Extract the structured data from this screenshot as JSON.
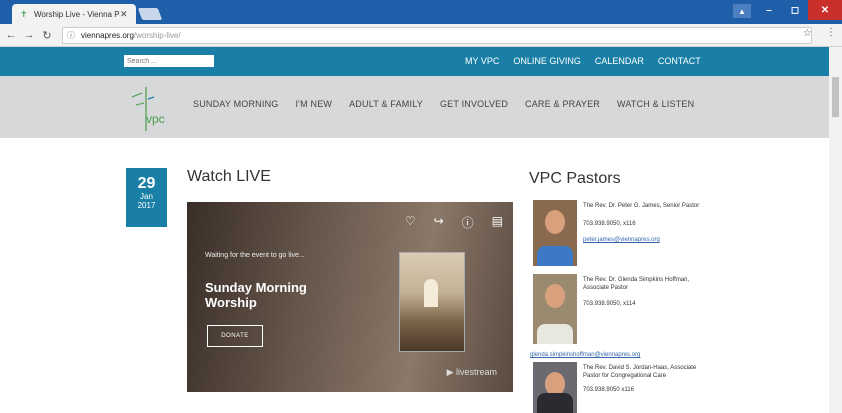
{
  "browser": {
    "tab_title": "Worship Live - Vienna P",
    "url_host": "viennapres.org",
    "url_path": "/worship-live/"
  },
  "site": {
    "search_placeholder": "Search ...",
    "top_links": [
      "MY VPC",
      "ONLINE GIVING",
      "CALENDAR",
      "CONTACT"
    ],
    "logo_text": "vpc",
    "nav_links": [
      "SUNDAY MORNING",
      "I'M NEW",
      "ADULT & FAMILY",
      "GET INVOLVED",
      "CARE & PRAYER",
      "WATCH & LISTEN"
    ]
  },
  "post": {
    "day": "29",
    "month": "Jan",
    "year": "2017",
    "title": "Watch LIVE"
  },
  "video": {
    "waiting_text": "Waiting for the event to go live...",
    "event_title": "Sunday Morning Worship",
    "donate_label": "DONATE",
    "brand": "livestream"
  },
  "pastors": {
    "title": "VPC Pastors",
    "items": [
      {
        "name": "The Rev. Dr. Peter G. James, Senior Pastor",
        "phone": "703.938.9050, x116",
        "email": "peter.james@viennapres.org"
      },
      {
        "name": "The Rev. Dr. Glenda Simpkins Hoffman, Associate Pastor",
        "phone": "703.938.9050, x114",
        "email": "glenda.simpkinshoffman@viennapres.org"
      },
      {
        "name": "The Rev. David S. Jordan-Haas, Associate Pastor for Congregational Care",
        "phone": "703.938.9050 x116",
        "email": ""
      }
    ]
  },
  "colors": {
    "brand_blue": "#1a7fa6",
    "nav_gray": "#d7d8da",
    "chrome_blue": "#1f5fa9"
  }
}
